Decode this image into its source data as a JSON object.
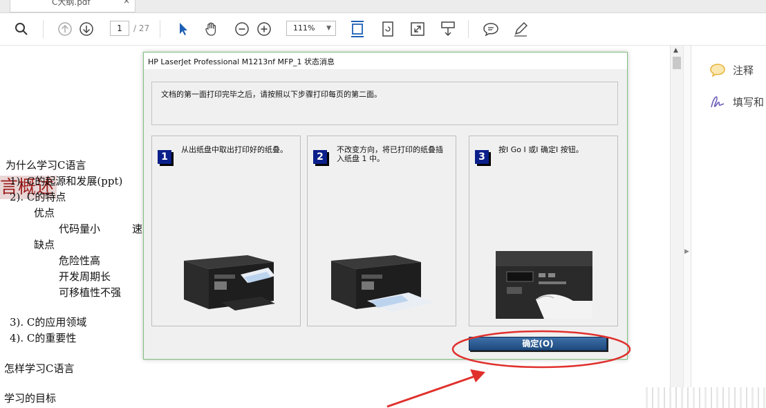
{
  "tab": {
    "label": "C大纲.pdf",
    "close": "×"
  },
  "toolbar": {
    "page_current": "1",
    "page_total": "/ 27",
    "zoom": "111%",
    "icons": [
      "search-icon",
      "page-up-icon",
      "page-down-icon",
      "select-arrow-icon",
      "hand-tool-icon",
      "zoom-out-icon",
      "zoom-in-icon",
      "fit-page-icon",
      "rotate-page-icon",
      "full-screen-icon",
      "read-mode-icon",
      "comment-icon",
      "pen-icon"
    ]
  },
  "document": {
    "title": "言概述",
    "lines": [
      "为什么学习C语言",
      "1).  C的起源和发展(ppt)",
      "2).  C的特点",
      "优点",
      "代码量小",
      "速",
      "缺点",
      "危险性高",
      "开发周期长",
      "可移植性不强",
      "3).  C的应用领域",
      "4).  C的重要性",
      "怎样学习C语言",
      "学习的目标"
    ]
  },
  "right_panel": {
    "comment_label": "注释",
    "fill_sign_label": "填写和"
  },
  "dialog": {
    "title": "HP LaserJet Professional M1213nf MFP_1 状态消息",
    "message": "文档的第一面打印完毕之后，请按照以下步骤打印每页的第二面。",
    "steps": [
      {
        "number": "1",
        "text": "从出纸盘中取出打印好的纸叠。"
      },
      {
        "number": "2",
        "text": "不改变方向，将已打印的纸叠插入纸盘 1 中。"
      },
      {
        "number": "3",
        "text": "按I Go I 或I 确定I 按钮。"
      }
    ],
    "ok_button": "确定(O)"
  },
  "colors": {
    "annotation_red": "#e0302c",
    "button_blue": "#2a5a92",
    "step_badge": "#0a1f8a",
    "title_red": "#9c1b1b"
  }
}
